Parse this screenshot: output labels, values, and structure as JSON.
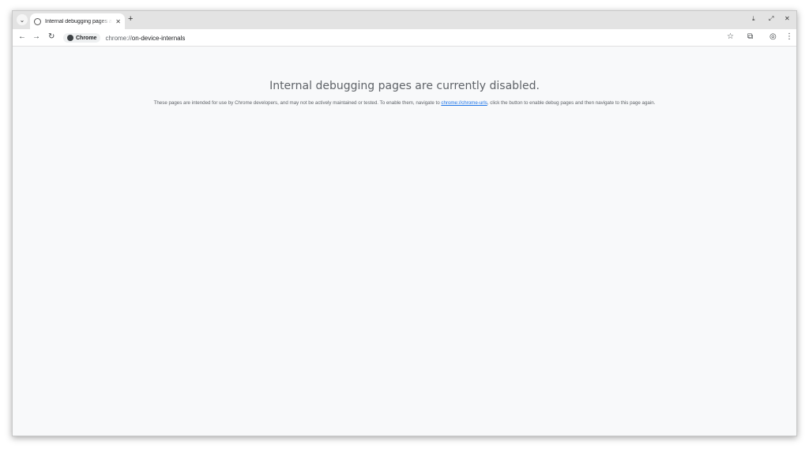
{
  "tab": {
    "title": "Internal debugging pages are currently disabled.",
    "close_glyph": "✕",
    "new_tab_glyph": "+"
  },
  "window_controls": {
    "minimize": "⤓",
    "restore": "⤢",
    "close": "✕"
  },
  "toolbar": {
    "back": "←",
    "forward": "→",
    "reload": "↻",
    "chip_label": "Chrome",
    "url_scheme": "chrome://",
    "url_path": "on-device-internals",
    "bookmark": "☆",
    "extensions": "⧉",
    "profile": "◎",
    "menu": "⋮"
  },
  "page": {
    "headline": "Internal debugging pages are currently disabled.",
    "desc_before": "These pages are intended for use by Chrome developers, and may not be actively maintained or tested. To enable them, navigate to ",
    "desc_link": "chrome://chrome-urls",
    "desc_after": ", click the button to enable debug pages and then navigate to this page again."
  },
  "colors": {
    "page_bg": "#f8f9fa",
    "text_secondary": "#5f6368",
    "link": "#1a73e8",
    "tabstrip_bg": "#e3e3e3"
  }
}
